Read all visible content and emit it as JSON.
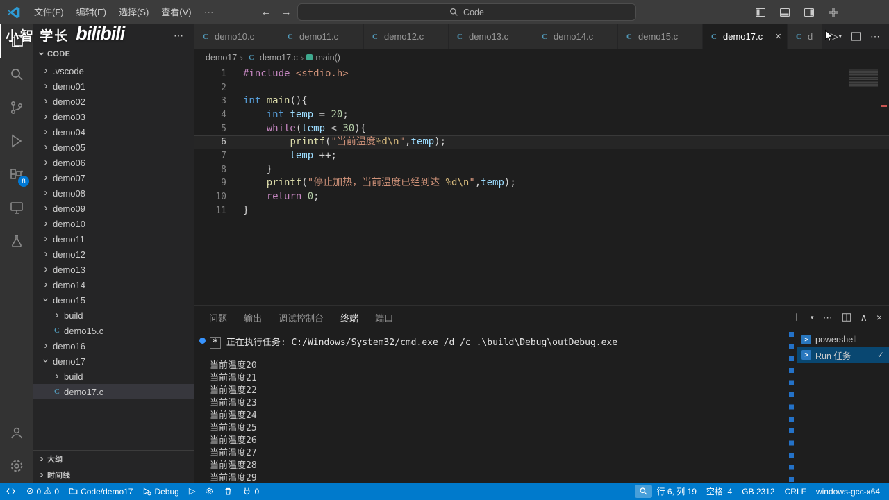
{
  "colors": {
    "statusbar_bg": "#007acc",
    "activity_badge": "#0078d4",
    "c_icon": "#519aba",
    "terminal_decoration": "#2472c8",
    "selection": "#094771",
    "active_tab_bg": "#1e1e1e"
  },
  "titlebar": {
    "menus": [
      {
        "label": "文件(F)"
      },
      {
        "label": "编辑(E)"
      },
      {
        "label": "选择(S)"
      },
      {
        "label": "查看(V)"
      }
    ],
    "search_label": "Code"
  },
  "watermark": {
    "line1": "小智 学长",
    "line2": "bilibili"
  },
  "activitybar": {
    "extensions_badge": "8"
  },
  "sidebar": {
    "section_title": "CODE",
    "tree": [
      {
        "label": ".vscode",
        "type": "folder",
        "depth": 0,
        "expanded": false
      },
      {
        "label": "demo01",
        "type": "folder",
        "depth": 0,
        "expanded": false
      },
      {
        "label": "demo02",
        "type": "folder",
        "depth": 0,
        "expanded": false
      },
      {
        "label": "demo03",
        "type": "folder",
        "depth": 0,
        "expanded": false
      },
      {
        "label": "demo04",
        "type": "folder",
        "depth": 0,
        "expanded": false
      },
      {
        "label": "demo05",
        "type": "folder",
        "depth": 0,
        "expanded": false
      },
      {
        "label": "demo06",
        "type": "folder",
        "depth": 0,
        "expanded": false
      },
      {
        "label": "demo07",
        "type": "folder",
        "depth": 0,
        "expanded": false
      },
      {
        "label": "demo08",
        "type": "folder",
        "depth": 0,
        "expanded": false
      },
      {
        "label": "demo09",
        "type": "folder",
        "depth": 0,
        "expanded": false
      },
      {
        "label": "demo10",
        "type": "folder",
        "depth": 0,
        "expanded": false
      },
      {
        "label": "demo11",
        "type": "folder",
        "depth": 0,
        "expanded": false
      },
      {
        "label": "demo12",
        "type": "folder",
        "depth": 0,
        "expanded": false
      },
      {
        "label": "demo13",
        "type": "folder",
        "depth": 0,
        "expanded": false
      },
      {
        "label": "demo14",
        "type": "folder",
        "depth": 0,
        "expanded": false
      },
      {
        "label": "demo15",
        "type": "folder",
        "depth": 0,
        "expanded": true
      },
      {
        "label": "build",
        "type": "folder",
        "depth": 1,
        "expanded": false
      },
      {
        "label": "demo15.c",
        "type": "cfile",
        "depth": 1
      },
      {
        "label": "demo16",
        "type": "folder",
        "depth": 0,
        "expanded": false
      },
      {
        "label": "demo17",
        "type": "folder",
        "depth": 0,
        "expanded": true
      },
      {
        "label": "build",
        "type": "folder",
        "depth": 1,
        "expanded": false
      },
      {
        "label": "demo17.c",
        "type": "cfile",
        "depth": 1,
        "selected": true
      }
    ],
    "bottom_sections": [
      "大纲",
      "时间线"
    ]
  },
  "tabbar": {
    "tabs": [
      {
        "label": "demo10.c"
      },
      {
        "label": "demo11.c"
      },
      {
        "label": "demo12.c"
      },
      {
        "label": "demo13.c"
      },
      {
        "label": "demo14.c"
      },
      {
        "label": "demo15.c"
      },
      {
        "label": "demo17.c",
        "active": true
      },
      {
        "label": "d",
        "partial": true
      }
    ]
  },
  "breadcrumb": {
    "items": [
      "demo17",
      "demo17.c",
      "main()"
    ]
  },
  "editor": {
    "lines": [
      {
        "n": 1,
        "tokens": [
          [
            "pp",
            "#include "
          ],
          [
            "str",
            "<stdio.h>"
          ]
        ]
      },
      {
        "n": 2,
        "tokens": []
      },
      {
        "n": 3,
        "tokens": [
          [
            "kw",
            "int "
          ],
          [
            "fn",
            "main"
          ],
          [
            "def",
            "(){"
          ]
        ]
      },
      {
        "n": 4,
        "tokens": [
          [
            "def",
            "    "
          ],
          [
            "kw",
            "int "
          ],
          [
            "var",
            "temp"
          ],
          [
            "def",
            " = "
          ],
          [
            "num",
            "20"
          ],
          [
            "def",
            ";"
          ]
        ]
      },
      {
        "n": 5,
        "tokens": [
          [
            "def",
            "    "
          ],
          [
            "pp",
            "while"
          ],
          [
            "def",
            "("
          ],
          [
            "var",
            "temp"
          ],
          [
            "def",
            " < "
          ],
          [
            "num",
            "30"
          ],
          [
            "def",
            "){"
          ]
        ]
      },
      {
        "n": 6,
        "current": true,
        "tokens": [
          [
            "def",
            "        "
          ],
          [
            "fn",
            "printf"
          ],
          [
            "def",
            "("
          ],
          [
            "str",
            "\"当前温度"
          ],
          [
            "esc",
            "%d\\n"
          ],
          [
            "str",
            "\""
          ],
          [
            "def",
            ","
          ],
          [
            "var",
            "temp"
          ],
          [
            "def",
            ");"
          ]
        ]
      },
      {
        "n": 7,
        "tokens": [
          [
            "def",
            "        "
          ],
          [
            "var",
            "temp"
          ],
          [
            "def",
            " ++;"
          ]
        ]
      },
      {
        "n": 8,
        "tokens": [
          [
            "def",
            "    }"
          ]
        ]
      },
      {
        "n": 9,
        "tokens": [
          [
            "def",
            "    "
          ],
          [
            "fn",
            "printf"
          ],
          [
            "def",
            "("
          ],
          [
            "str",
            "\"停止加热，当前温度已经到达 "
          ],
          [
            "esc",
            "%d\\n"
          ],
          [
            "str",
            "\""
          ],
          [
            "def",
            ","
          ],
          [
            "var",
            "temp"
          ],
          [
            "def",
            ");"
          ]
        ]
      },
      {
        "n": 10,
        "tokens": [
          [
            "def",
            "    "
          ],
          [
            "pp",
            "return "
          ],
          [
            "num",
            "0"
          ],
          [
            "def",
            ";"
          ]
        ]
      },
      {
        "n": 11,
        "tokens": [
          [
            "def",
            "}"
          ]
        ]
      }
    ]
  },
  "panel": {
    "tabs": [
      {
        "label": "问题"
      },
      {
        "label": "输出"
      },
      {
        "label": "调试控制台"
      },
      {
        "label": "终端",
        "active": true
      },
      {
        "label": "端口"
      }
    ],
    "task_prefix": "*",
    "task_line": "正在执行任务: C:/Windows/System32/cmd.exe /d /c .\\build\\Debug\\outDebug.exe",
    "output_lines": [
      "当前温度20",
      "当前温度21",
      "当前温度22",
      "当前温度23",
      "当前温度24",
      "当前温度25",
      "当前温度26",
      "当前温度27",
      "当前温度28",
      "当前温度29"
    ],
    "terminals": [
      {
        "label": "powershell"
      },
      {
        "label": "Run 任务",
        "selected": true
      }
    ]
  },
  "statusbar": {
    "errors": "0",
    "warnings": "0",
    "workspace": "Code/demo17",
    "debug": "Debug",
    "plug_count": "0",
    "line_col": "行 6, 列 19",
    "spaces": "空格: 4",
    "encoding": "GB 2312",
    "eol": "CRLF",
    "compiler": "windows-gcc-x64"
  }
}
